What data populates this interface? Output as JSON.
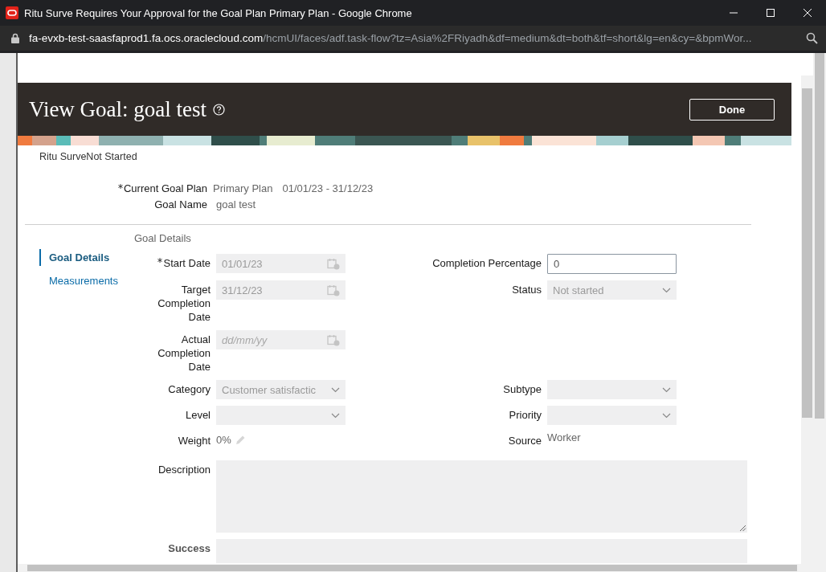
{
  "window": {
    "title": "Ritu Surve Requires Your Approval for the Goal Plan Primary Plan - Google Chrome"
  },
  "address_bar": {
    "host": "fa-evxb-test-saasfaprod1.fa.ocs.oraclecloud.com",
    "path": "/hcmUI/faces/adf.task-flow?tz=Asia%2FRiyadh&df=medium&dt=both&tf=short&lg=en&cy=&bpmWor..."
  },
  "header": {
    "title": "View Goal: goal test",
    "done_button": "Done"
  },
  "subtitle": "Ritu SurveNot Started",
  "summary": [
    {
      "label": "Current Goal Plan",
      "required": true,
      "value": "Primary Plan",
      "extra": "01/01/23 - 31/12/23"
    },
    {
      "label": "Goal Name",
      "required": false,
      "value": "goal test"
    }
  ],
  "section_title": "Goal Details",
  "nav": [
    {
      "label": "Goal Details",
      "selected": true
    },
    {
      "label": "Measurements",
      "selected": false
    }
  ],
  "rows": [
    {
      "left": {
        "kind": "date",
        "label": "Start Date",
        "required": true,
        "value": "01/01/23"
      },
      "right": {
        "kind": "text",
        "label": "Completion Percentage",
        "required": false,
        "value": "0"
      }
    },
    {
      "left": {
        "kind": "date",
        "label": "Target Completion Date",
        "required": false,
        "value": "31/12/23"
      },
      "right": {
        "kind": "select",
        "label": "Status",
        "required": false,
        "value": "Not started"
      }
    },
    {
      "left": {
        "kind": "date",
        "label": "Actual Completion Date",
        "required": false,
        "placeholder": "dd/mm/yy"
      }
    },
    {
      "left": {
        "kind": "select",
        "label": "Category",
        "required": false,
        "value": "Customer satisfactic"
      },
      "right": {
        "kind": "select",
        "label": "Subtype",
        "required": false
      }
    },
    {
      "left": {
        "kind": "select",
        "label": "Level",
        "required": false
      },
      "right": {
        "kind": "select",
        "label": "Priority",
        "required": false
      }
    },
    {
      "left": {
        "kind": "weight",
        "label": "Weight",
        "required": false,
        "value": "0%"
      },
      "right": {
        "kind": "readonly",
        "label": "Source",
        "required": false,
        "value": "Worker"
      }
    }
  ],
  "wide_fields": [
    {
      "label": "Description",
      "kind": "textarea"
    },
    {
      "label": "Success",
      "kind": "cut"
    }
  ]
}
